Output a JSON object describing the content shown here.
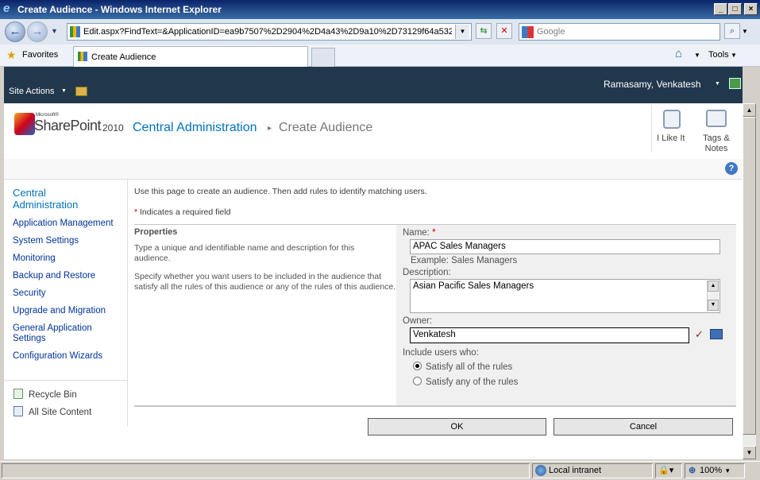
{
  "window": {
    "title": "Create Audience - Windows Internet Explorer"
  },
  "browser": {
    "address": "Edit.aspx?FindText=&ApplicationID=ea9b7507%2D2904%2D4a43%2D9a10%2D73129f64a532",
    "search_placeholder": "Google",
    "favorites_label": "Favorites",
    "tab_title": "Create Audience",
    "tools_label": "Tools"
  },
  "ribbon": {
    "site_actions": "Site Actions",
    "user": "Ramasamy, Venkatesh"
  },
  "header": {
    "brand_small": "Microsoft®",
    "brand": "SharePoint",
    "brand_year": "2010",
    "breadcrumb_root": "Central Administration",
    "breadcrumb_sep": "▸",
    "page_title": "Create Audience",
    "like_label": "I Like It",
    "tags_label": "Tags &",
    "notes_label": "Notes"
  },
  "leftnav": {
    "heading": "Central Administration",
    "items": [
      "Application Management",
      "System Settings",
      "Monitoring",
      "Backup and Restore",
      "Security",
      "Upgrade and Migration",
      "General Application Settings",
      "Configuration Wizards"
    ],
    "recycle": "Recycle Bin",
    "all_content": "All Site Content"
  },
  "content": {
    "intro": "Use this page to create an audience. Then add rules to identify matching users.",
    "required_marker": "*",
    "required_note": "Indicates a required field",
    "section_title": "Properties",
    "section_desc1": "Type a unique and identifiable name and description for this audience.",
    "section_desc2": "Specify whether you want users to be included in the audience that satisfy all the rules of this audience or any of the rules of this audience.",
    "name_label": "Name:",
    "name_value": "APAC Sales Managers",
    "name_example": "Example: Sales Managers",
    "desc_label": "Description:",
    "desc_value": "Asian Pacific Sales Managers",
    "owner_label": "Owner:",
    "owner_value": "Venkatesh",
    "include_label": "Include users who:",
    "option_all": "Satisfy all of the rules",
    "option_any": "Satisfy any of the rules",
    "ok": "OK",
    "cancel": "Cancel"
  },
  "status": {
    "zone": "Local intranet",
    "zoom": "100%"
  }
}
